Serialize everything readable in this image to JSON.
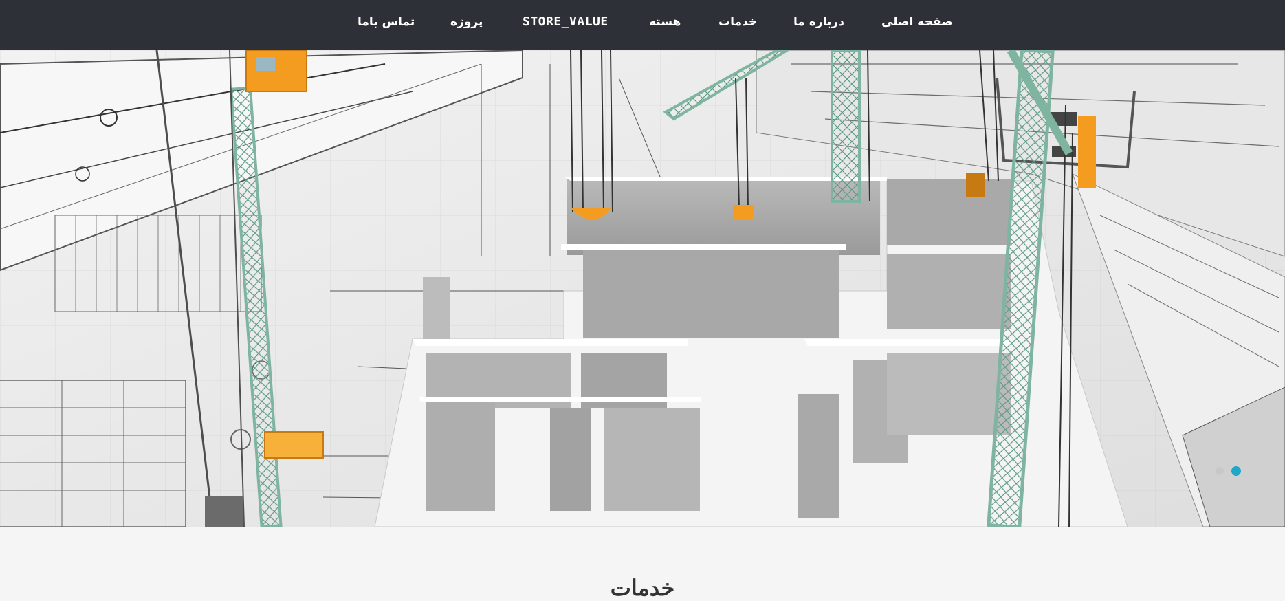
{
  "nav": {
    "items": [
      {
        "id": "home",
        "label": "صفحه اصلی"
      },
      {
        "id": "about",
        "label": "درباره ما"
      },
      {
        "id": "services",
        "label": "خدمات"
      },
      {
        "id": "core",
        "label": "هسته"
      },
      {
        "id": "store",
        "label": "STORE_VALUE"
      },
      {
        "id": "project",
        "label": "پروژه"
      },
      {
        "id": "contact",
        "label": "تماس باما"
      }
    ]
  },
  "hero": {
    "image": "construction-blueprint-cranes",
    "active_slide_dot_color": "#1fa7c9"
  },
  "services_section": {
    "title": "خدمات"
  },
  "colors": {
    "topbar": "#2d3036",
    "crane": "#7fb5a0",
    "crane_accent": "#f39c1f",
    "page_background": "#f5f5f5"
  }
}
